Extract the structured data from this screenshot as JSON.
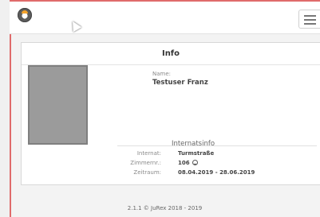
{
  "header": {
    "logo_icon": "app-logo-icon",
    "menu_icon": "hamburger-menu-icon"
  },
  "info_panel": {
    "title": "Info",
    "name_label": "Name:",
    "name_value": "Testuser Franz",
    "section_title": "Internatsinfo",
    "fields": [
      {
        "label": "Internat:",
        "value": "Turmstraße"
      },
      {
        "label": "Zimmernr.:",
        "value": "106"
      },
      {
        "label": "Zeitraum:",
        "value": "08.04.2019 - 28.06.2019"
      }
    ]
  },
  "footer": {
    "text": "2.1.1 © JuRex 2018 - 2019"
  },
  "colors": {
    "accent_border": "#e06b6b",
    "panel_bg": "#ffffff",
    "page_bg": "#f3f3f3",
    "photo_placeholder": "#9b9b9b"
  }
}
